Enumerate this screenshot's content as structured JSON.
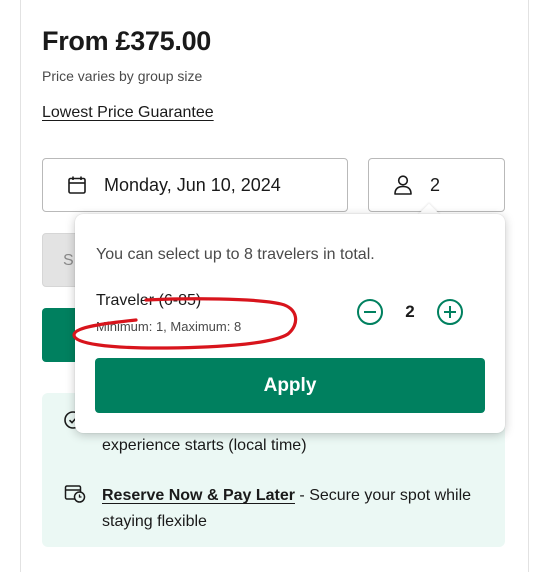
{
  "pricing": {
    "price": "From £375.00",
    "note": "Price varies by group size",
    "guarantee_link": "Lowest Price Guarantee"
  },
  "booking": {
    "date": "Monday, Jun 10, 2024",
    "travelers": "2",
    "check_button_partial": "S"
  },
  "traveler_popup": {
    "info": "You can select up to 8 travelers in total.",
    "category_label": "Traveler (6-85)",
    "limits": "Minimum: 1, Maximum: 8",
    "count": "2",
    "apply_label": "Apply"
  },
  "info_box": {
    "line1": "experience starts (local time)",
    "reserve_link": "Reserve Now & Pay Later",
    "reserve_text": " - Secure your spot while staying flexible"
  },
  "colors": {
    "brand_green": "#00805f",
    "info_bg": "#ebf8f4",
    "annotation_red": "#d8141c"
  },
  "icons": [
    "calendar-icon",
    "person-icon",
    "clock-check-icon",
    "calendar-clock-icon",
    "minus-icon",
    "plus-icon"
  ]
}
